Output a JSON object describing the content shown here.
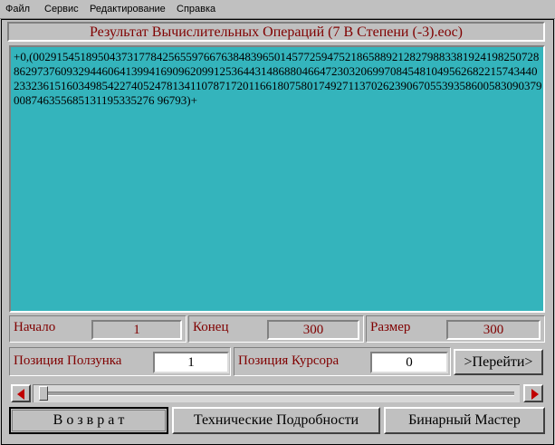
{
  "menu": {
    "file": "Файл",
    "service": "Сервис",
    "edit": "Редактирование",
    "help": "Справка"
  },
  "title": "Результат Вычислительных Операций (7 В Степени (-3).eoc)",
  "result_text": "+0,(0029154518950437317784256559766763848396501457725947521865889212827988338192419825072886297376093294460641399416909620991253644314868804664723032069970845481049562682215743440233236151603498542274052478134110787172011661807580174927113702623906705539358600583090379008746355685131195335276 96793)+",
  "fields": {
    "start_label": "Начало",
    "start_value": "1",
    "end_label": "Конец",
    "end_value": "300",
    "size_label": "Размер",
    "size_value": "300",
    "slider_pos_label": "Позиция Ползунка",
    "slider_pos_value": "1",
    "cursor_pos_label": "Позиция Курсора",
    "cursor_pos_value": "0"
  },
  "slider": {
    "position_fraction": 0.0
  },
  "buttons": {
    "goto": ">Перейти>",
    "back": "В о з в р а т",
    "tech": "Технические Подробности",
    "binary": "Бинарный Мастер"
  },
  "colors": {
    "accent": "#800000",
    "result_bg": "#34b4bc",
    "arrow": "#c00000"
  }
}
